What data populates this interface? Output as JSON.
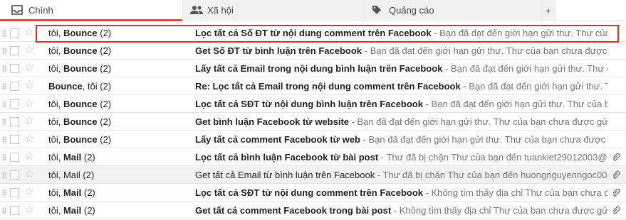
{
  "tabs": [
    {
      "label": "Chính",
      "icon": "inbox-icon",
      "active": true
    },
    {
      "label": "Xã hội",
      "icon": "people-icon",
      "active": false
    },
    {
      "label": "Quảng cáo",
      "icon": "tag-icon",
      "active": false
    }
  ],
  "add_tab_label": "+",
  "accent_color": "#dd4b39",
  "highlight_color": "#d93025",
  "emails": [
    {
      "sender_prefix": "tôi, ",
      "sender_bold": "Bounce",
      "count": " (2)",
      "subject": "Lọc tất cả Số ĐT từ nội dung comment trên Facebook",
      "snippet": " - Bạn đã đạt đến giới hạn gửi thư. Thư của",
      "read": false,
      "attachment": false
    },
    {
      "sender_prefix": "tôi, ",
      "sender_bold": "Bounce",
      "count": " (2)",
      "subject": "Get Số ĐT từ bình luận trên Facebook",
      "snippet": " - Bạn đã đạt đến giới hạn gửi thư. Thư của bạn chưa được g",
      "read": false,
      "attachment": false
    },
    {
      "sender_prefix": "tôi, ",
      "sender_bold": "Bounce",
      "count": " (2)",
      "subject": "Lấy tất cả Email trong nội dung bình luận trên Facebook",
      "snippet": " - Bạn đã đạt đến giới hạn gửi thư. Thư của bạn",
      "read": false,
      "attachment": false
    },
    {
      "sender_prefix": "",
      "sender_bold": "Bounce",
      "count": ", tôi (2)",
      "subject": "Re: Lọc tất cả Email trong nội dung comment trên Facebook",
      "snippet": " - Bạn đã đạt đến giới hạn gửi thư. Th",
      "read": false,
      "attachment": false
    },
    {
      "sender_prefix": "tôi, ",
      "sender_bold": "Bounce",
      "count": " (2)",
      "subject": "Lọc tất cả SĐT từ nội dung bình luận trên Facebook",
      "snippet": " - Bạn đã đạt đến giới hạn gửi thư. Thư của bạn",
      "read": false,
      "attachment": false
    },
    {
      "sender_prefix": "tôi, ",
      "sender_bold": "Bounce",
      "count": " (2)",
      "subject": "Get bình luận Facebook từ website",
      "snippet": " - Bạn đã đạt đến giới hạn gửi thư. Thư của bạn chưa được gửi.",
      "read": false,
      "attachment": false
    },
    {
      "sender_prefix": "tôi, ",
      "sender_bold": "Bounce",
      "count": " (2)",
      "subject": "Lấy tất cả comment Facebook từ web",
      "snippet": " - Bạn đã đạt đến giới hạn gửi thư. Thư của bạn chưa được g",
      "read": false,
      "attachment": false
    },
    {
      "sender_prefix": "tôi, ",
      "sender_bold": "Mail",
      "count": " (2)",
      "subject": "Lọc tất cả bình luận Facebook từ bài post",
      "snippet": " - Thư đã bị chặn Thư của bạn đến tuankiet29012003@g",
      "read": false,
      "attachment": true
    },
    {
      "sender_prefix": "tôi, ",
      "sender_bold": "Mail",
      "count": " (2)",
      "subject": "Get tất cả Email từ bình luận trên Facebook",
      "snippet": " - Thư đã bị chặn Thư của bạn đến huongnguyenngoc003",
      "read": true,
      "attachment": true
    },
    {
      "sender_prefix": "tôi, ",
      "sender_bold": "Mail",
      "count": " (2)",
      "subject": "Lọc tất cả SĐT từ nội dung comment trên Facebook",
      "snippet": " - Không tìm thấy địa chỉ Thư của bạn chưa được gửi",
      "read": false,
      "attachment": true
    },
    {
      "sender_prefix": "tôi, ",
      "sender_bold": "Mail",
      "count": " (2)",
      "subject": "Get tất cả comment Facebook trong bài post",
      "snippet": " - Không tìm thấy địa chỉ Thư của bạn chưa được gửi",
      "read": false,
      "attachment": true
    }
  ]
}
